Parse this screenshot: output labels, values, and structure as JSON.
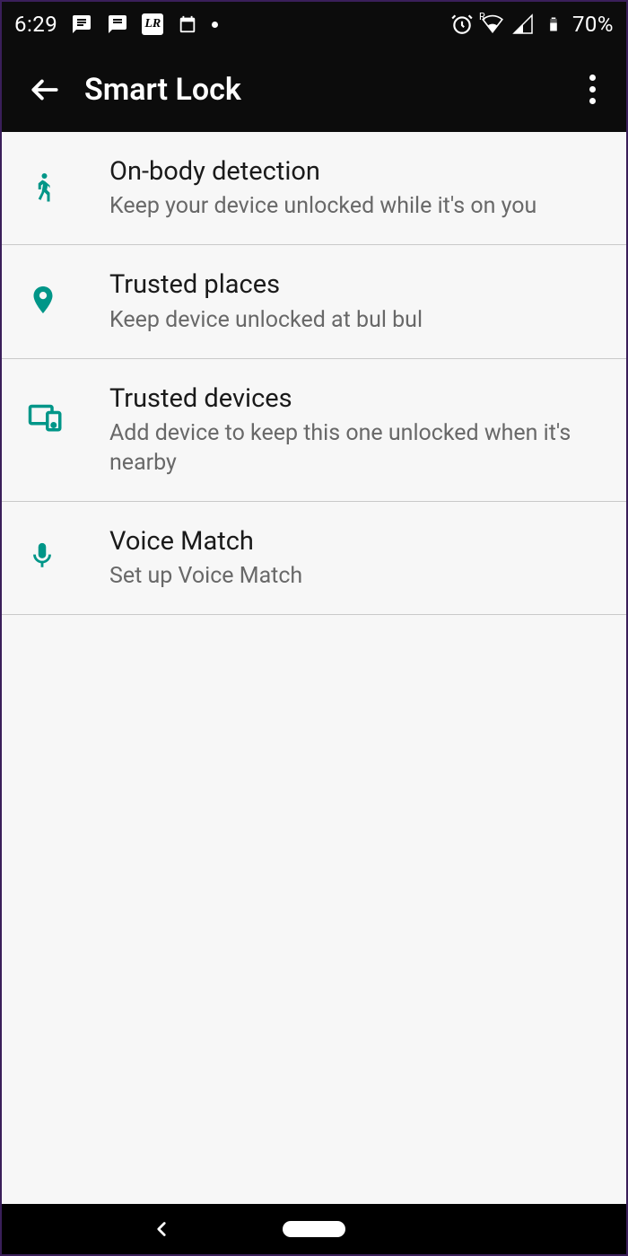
{
  "status": {
    "time": "6:29",
    "battery_pct": "70%",
    "wifi_r": "R"
  },
  "appbar": {
    "title": "Smart Lock"
  },
  "items": [
    {
      "title": "On-body detection",
      "sub": "Keep your device unlocked while it's on you"
    },
    {
      "title": "Trusted places",
      "sub": "Keep device unlocked at bul bul"
    },
    {
      "title": "Trusted devices",
      "sub": "Add device to keep this one unlocked when it's nearby"
    },
    {
      "title": "Voice Match",
      "sub": "Set up Voice Match"
    }
  ]
}
